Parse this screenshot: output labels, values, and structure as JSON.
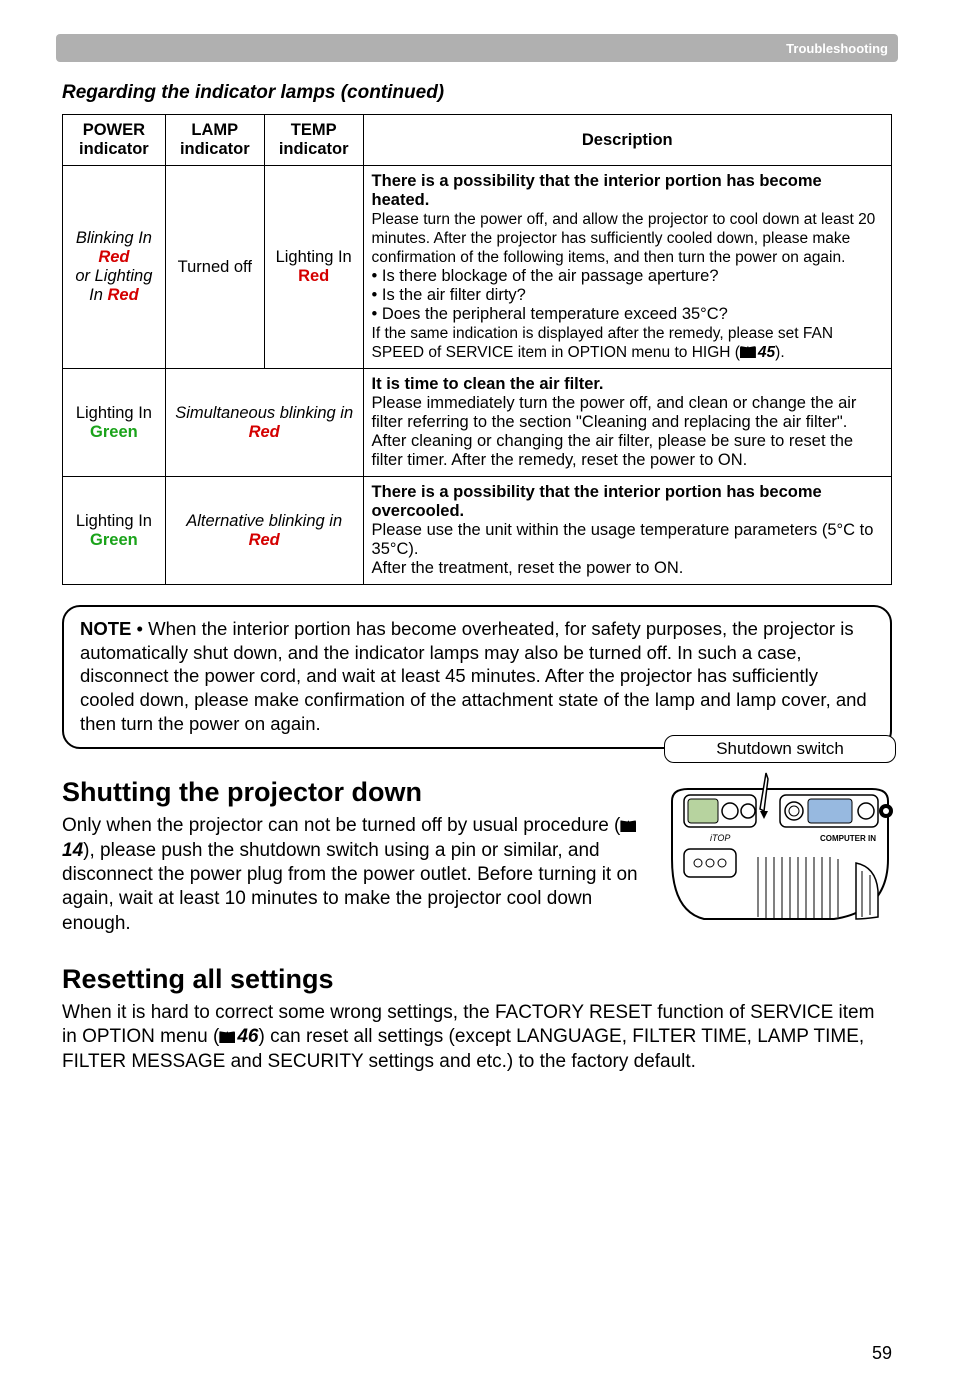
{
  "header": {
    "tag": "Troubleshooting"
  },
  "subheading": "Regarding the indicator lamps (continued)",
  "table": {
    "headers": {
      "power": "POWER indicator",
      "lamp": "LAMP indicator",
      "temp": "TEMP indicator",
      "desc": "Description"
    },
    "rows": [
      {
        "power_pre": "Blinking In ",
        "power_red1": "Red",
        "power_mid": "or Lighting In ",
        "power_red2": "Red",
        "lamp": "Turned off",
        "temp_pre": "Lighting In ",
        "temp_red": "Red",
        "desc_bold": "There is a possibility that the interior portion has become heated.",
        "desc_body1": "Please turn the power off, and allow the projector to cool down at least 20 minutes. After the projector has sufficiently cooled down, please make confirmation of the following items, and then turn the power on again.",
        "b1": "• Is there blockage of the air passage aperture?",
        "b2": "• Is the air filter dirty?",
        "b3": "• Does the peripheral temperature exceed 35°C?",
        "desc_body2a": "If the same indication is displayed after the remedy, please set FAN SPEED of SERVICE item in OPTION menu to HIGH (",
        "ref1": "45",
        "desc_body2b": ")."
      },
      {
        "power_pre": "Lighting In ",
        "power_green": "Green",
        "merged_pre": "Simultaneous blinking in ",
        "merged_red": "Red",
        "desc_bold": "It is time to clean the air filter.",
        "desc_body": "Please immediately turn the power off, and clean or change the air filter referring to the section \"Cleaning and replacing the air filter\". After cleaning or changing the air filter, please be sure to reset the filter timer. After the remedy, reset the power to ON."
      },
      {
        "power_pre": "Lighting In ",
        "power_green": "Green",
        "merged_pre": "Alternative blinking in ",
        "merged_red": "Red",
        "desc_bold": "There is a possibility that the interior portion has become overcooled.",
        "desc_body": "Please use the unit within the usage temperature parameters (5°C to 35°C).",
        "desc_body2": "After the treatment, reset the power to ON."
      }
    ]
  },
  "note": {
    "label": "NOTE",
    "text": " • When the interior portion has become overheated, for safety purposes, the projector is automatically shut down, and the indicator lamps may also be turned off. In such a case, disconnect the power cord, and wait at least 45 minutes. After the projector has sufficiently cooled down, please make confirmation of the attachment state of the lamp and lamp cover, and then turn the power on again."
  },
  "shutting": {
    "title": "Shutting the projector down",
    "para_a": "Only when the projector can not be turned off by usual procedure (",
    "ref": "14",
    "para_b": "), please push the shutdown switch using a pin or similar, and disconnect the power plug from the power outlet. Before turning it on again, wait at least 10 minutes to make the projector cool down enough.",
    "caption": "Shutdown switch"
  },
  "reset": {
    "title": "Resetting all settings",
    "para_a": "When it is hard to correct some wrong settings, the FACTORY RESET function of SERVICE item in OPTION menu (",
    "ref": "46",
    "para_b": ") can reset all settings (except LANGUAGE, FILTER TIME, LAMP TIME, FILTER MESSAGE and SECURITY settings and etc.) to the factory default."
  },
  "page": "59"
}
